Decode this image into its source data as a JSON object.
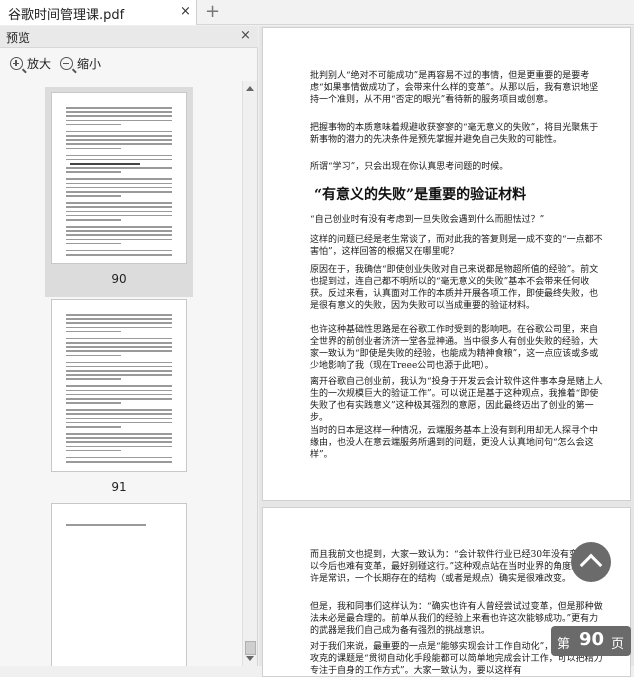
{
  "tab": {
    "title": "谷歌时间管理课.pdf",
    "close_icon": "×",
    "new_tab_icon": "+"
  },
  "sidebar": {
    "title": "预览",
    "close_icon": "×",
    "zoom_in_label": "放大",
    "zoom_out_label": "缩小",
    "thumbnails": [
      {
        "page_label": "90",
        "selected": true
      },
      {
        "page_label": "91",
        "selected": false
      },
      {
        "page_label": "",
        "selected": false
      }
    ]
  },
  "viewer": {
    "page90": {
      "para1": "批判别人“绝对不可能成功”是再容易不过的事情，但是更重要的是要考虑“如果事情做成功了，会带来什么样的变革”。从那以后，我有意识地坚持一个准则，从不用“否定的眼光”看待新的服务项目或创意。",
      "para2": "把握事物的本质意味着规避收获寥寥的“毫无意义的失败”，将目光聚焦于新事物的潜力的先决条件是预先掌握并避免自己失败的可能性。",
      "para3": "所谓“学习”，只会出现在你认真思考问题的时候。",
      "heading": "“有意义的失败”是重要的验证材料",
      "para4": "“自己创业时有没有考虑到一旦失败会遇到什么而胆怯过？”",
      "para5": "这样的问题已经是老生常谈了，而对此我的答复则是一成不变的“一点都不害怕”，这样回答的根据又在哪里呢？",
      "para6": "原因在于，我确信“即使创业失败对自己来说都是物超所值的经验”。前文也提到过，连自己都不明所以的“毫无意义的失败”基本不会带来任何收获。反过来看，认真面对工作的本质并开展各项工作，即使最终失败，也是很有意义的失败，因为失败可以当成重要的验证材料。",
      "para7": "也许这种基础性思路是在谷歌工作时受到的影响吧。在谷歌公司里，来自全世界的前创业者济济一堂各显神通。当中很多人有创业失败的经验，大家一致认为“即使是失败的经验，也能成为精神食粮”，这一点应该或多或少地影响了我（现在Treee公司也源于此吧）。",
      "para8": "离开谷歌自己创业前，我认为“投身于开发云会计软件这件事本身是赌上人生的一次规模巨大的验证工作”。可以说正是基于这种观点，我推着“即使失败了也有实践意义”这种极其强烈的意愿，因此最终迈出了创业的第一步。",
      "para9": "当时的日本是这样一种情况，云端服务基本上没有到利用却无人探寻个中缘由，也没人在意云端服务所遇到的问题，更没人认真地问句“怎么会这样”。"
    },
    "page91": {
      "para1": "而且我前文也提到，大家一致认为：“会计软件行业已经30年没有变化，所以今后也难有变革，最好别碰这行。”这种观点站在当时业界的角度来说也许是常识，一个长期存在的结构（或者是规点）确实是很难改变。",
      "para2": "但是，我和同事们这样认为：“确实也许有人曾经尝试过变革，但是那种做法未必是最合理的。前单从我们的经验上来看也许这次能够成功。”更有力的武器是我们自己成为备有强烈的挑战意识。",
      "para3": "对于我们来说，最重要的一点是“能够实现会计工作自动化”，而接下来要攻克的课题是“贯彻自动化手段能都可以简单地完成会计工作，可以把精力专注于自身的工作方式”。大家一致认为，要以这样有"
    },
    "page_indicator": {
      "prefix": "第",
      "number": "90",
      "suffix": "页"
    },
    "scroll_top_icon": "chevron-up"
  }
}
